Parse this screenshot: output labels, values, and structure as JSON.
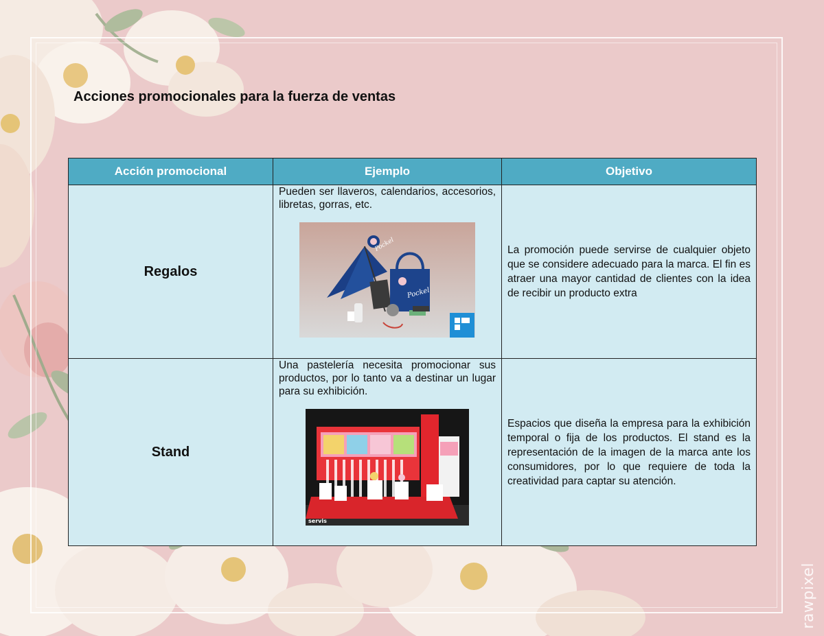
{
  "document": {
    "title": "Acciones promocionales para la fuerza de ventas",
    "watermark": "rawpixel"
  },
  "table": {
    "headers": [
      "Acción promocional",
      "Ejemplo",
      "Objetivo"
    ],
    "rows": [
      {
        "accion": "Regalos",
        "ejemplo": "Pueden ser llaveros, calendarios, accesorios, libretas, gorras, etc.",
        "objetivo": "La promoción puede servirse de cualquier objeto que se considere adecuado para la marca.  El fin es atraer una mayor cantidad de clientes con la idea de recibir un producto extra",
        "image": {
          "brand_text": "Pockel"
        }
      },
      {
        "accion": "Stand",
        "ejemplo": "Una pastelería necesita promocionar sus productos, por lo tanto va a destinar un lugar para su exhibición.",
        "objetivo": "Espacios que diseña la empresa para la exhibición temporal o fija de los productos. El stand es la representación de la imagen de la marca ante los consumidores, por lo que requiere de toda la creatividad para captar su atención.",
        "image": {
          "brand_text": "servis"
        }
      }
    ]
  },
  "colors": {
    "background": "#ebcaca",
    "header_fill": "#4fabc4",
    "cell_fill": "#d2ebf2",
    "border": "#222222"
  }
}
